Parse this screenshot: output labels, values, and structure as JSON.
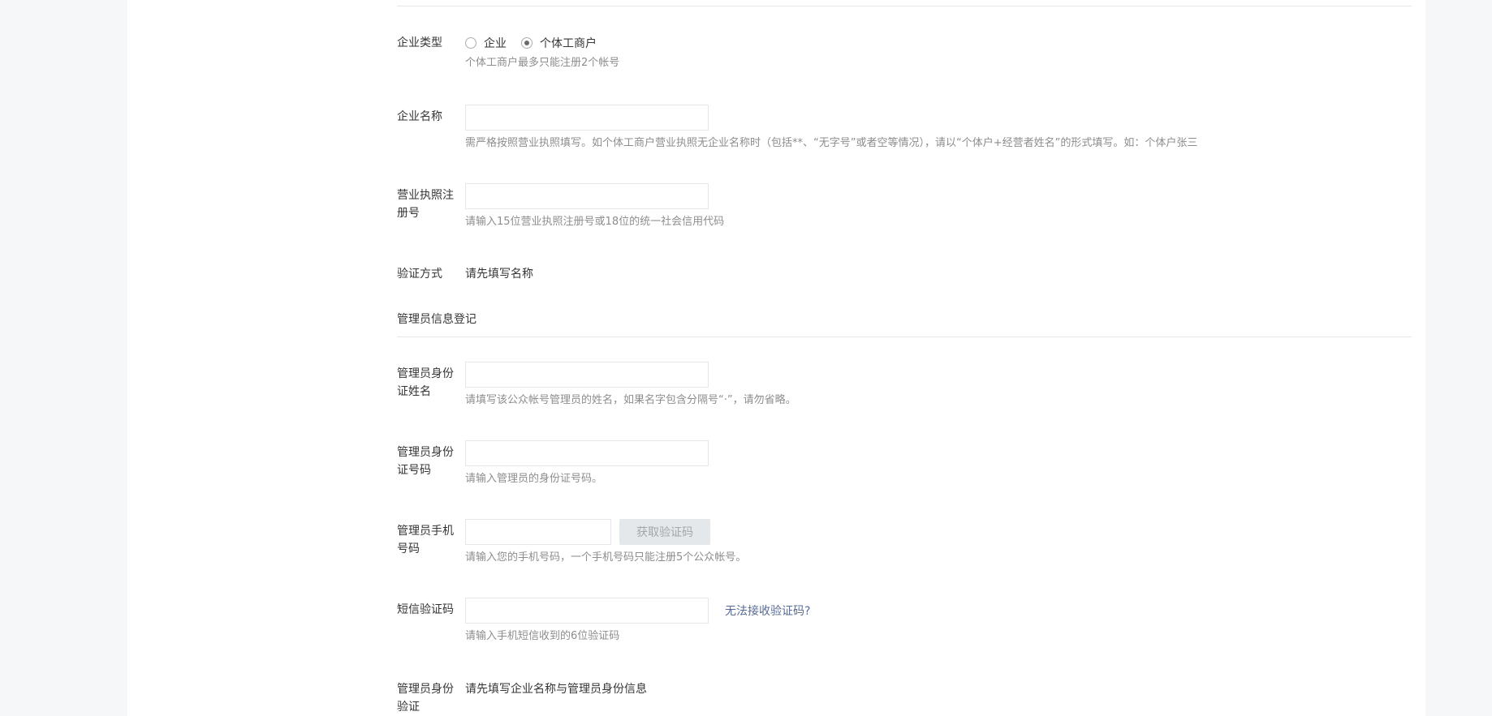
{
  "enterprise_type": {
    "label": "企业类型",
    "options": [
      {
        "label": "企业",
        "checked": false
      },
      {
        "label": "个体工商户",
        "checked": true
      }
    ],
    "tip": "个体工商户最多只能注册2个帐号"
  },
  "enterprise_name": {
    "label": "企业名称",
    "value": "",
    "tip": "需严格按照营业执照填写。如个体工商户营业执照无企业名称时（包括**、“无字号”或者空等情况），请以“个体户+经营者姓名”的形式填写。如：个体户张三"
  },
  "license_number": {
    "label_line1": "营业执照注",
    "label_line2": "册号",
    "value": "",
    "tip": "请输入15位营业执照注册号或18位的统一社会信用代码"
  },
  "verify_method": {
    "label": "验证方式",
    "text": "请先填写名称"
  },
  "admin_section": {
    "title": "管理员信息登记"
  },
  "admin_name": {
    "label_line1": "管理员身份",
    "label_line2": "证姓名",
    "value": "",
    "tip": "请填写该公众帐号管理员的姓名，如果名字包含分隔号“·”，请勿省略。"
  },
  "admin_id": {
    "label_line1": "管理员身份",
    "label_line2": "证号码",
    "value": "",
    "tip": "请输入管理员的身份证号码。"
  },
  "admin_phone": {
    "label_line1": "管理员手机",
    "label_line2": "号码",
    "value": "",
    "button_label": "获取验证码",
    "tip": "请输入您的手机号码，一个手机号码只能注册5个公众帐号。"
  },
  "sms_code": {
    "label": "短信验证码",
    "value": "",
    "link_label": "无法接收验证码?",
    "tip": "请输入手机短信收到的6位验证码"
  },
  "admin_verify": {
    "label_line1": "管理员身份",
    "label_line2": "验证",
    "text": "请先填写企业名称与管理员身份信息"
  }
}
